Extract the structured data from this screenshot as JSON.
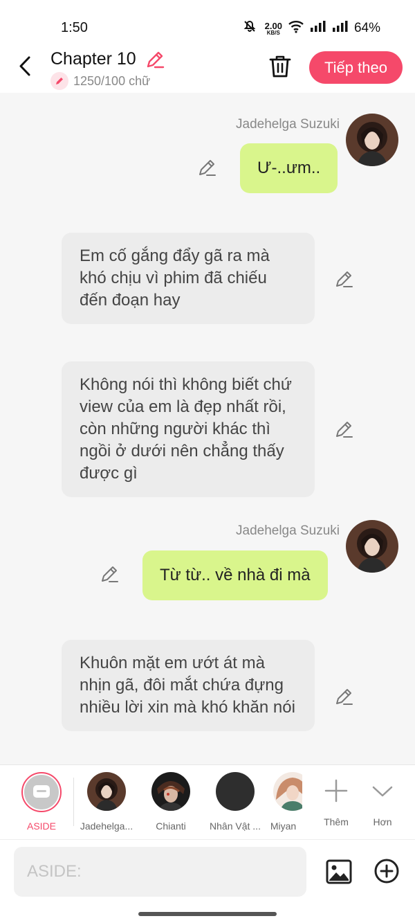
{
  "status": {
    "time": "1:50",
    "speed_value": "2.00",
    "speed_unit": "KB/S",
    "battery": "64%"
  },
  "header": {
    "title": "Chapter 10",
    "word_count": "1250/100 chữ",
    "next_label": "Tiếp theo"
  },
  "messages": [
    {
      "type": "me",
      "sender": "Jadehelga Suzuki",
      "text": "Ư-..ưm.."
    },
    {
      "type": "other",
      "text": "Em cố gắng đẩy gã ra mà khó chịu vì phim đã chiếu đến đoạn hay"
    },
    {
      "type": "other",
      "text": "Không nói thì không biết chứ view của em là đẹp nhất rồi, còn những người khác thì ngồi ở dưới nên chẳng thấy được gì"
    },
    {
      "type": "me",
      "sender": "Jadehelga Suzuki",
      "text": "Từ từ.. về nhà đi mà"
    },
    {
      "type": "other",
      "text": "Khuôn mặt em ướt át mà nhịn gã, đôi mắt chứa đựng nhiều lời xin mà khó khăn nói"
    }
  ],
  "characters": [
    {
      "label": "ASIDE"
    },
    {
      "label": "Jadehelga..."
    },
    {
      "label": "Chianti"
    },
    {
      "label": "Nhân Vật ..."
    },
    {
      "label": "Miyan"
    }
  ],
  "actions": {
    "more_label": "Thêm",
    "less_label": "Hơn"
  },
  "input": {
    "placeholder": "ASIDE:"
  },
  "colors": {
    "accent": "#f5496a",
    "my_bubble": "#d9f58c",
    "other_bubble": "#ececec"
  }
}
